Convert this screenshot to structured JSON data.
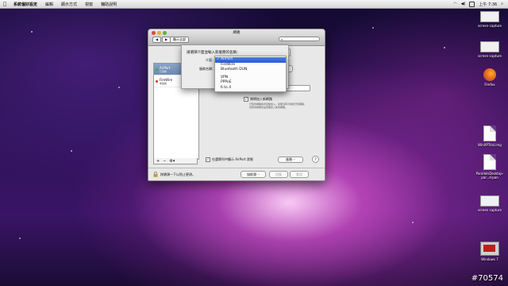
{
  "menubar": {
    "app_name": "系統偏好設定",
    "items": [
      "編輯",
      "顯示方式",
      "視窗",
      "輔助說明"
    ],
    "clock": "上午 7:36",
    "status_icons": [
      "wifi-icon",
      "volume-icon",
      "flag-icon",
      "spotlight-icon"
    ]
  },
  "window": {
    "title": "網路",
    "nav_back": "◀",
    "nav_forward": "▶",
    "show_all": "顯示全部",
    "search_placeholder": ""
  },
  "sheet": {
    "question": "請選擇介面並輸入新服務的名稱：",
    "interface_label": "介面：",
    "service_name_label": "服務名稱："
  },
  "interface_menu": {
    "selected": "AirPort",
    "options": [
      "AirPort",
      "FireWire",
      "Bluetooth DUN",
      "VPN",
      "PPPoE",
      "6 to 4"
    ]
  },
  "services": [
    {
      "name": "AirPort",
      "status": "已連線",
      "color": "#2fb24a",
      "selected": true
    },
    {
      "name": "FireWire",
      "status": "未連線",
      "color": "#d62b2b",
      "selected": false
    }
  ],
  "detail": {
    "airport_button": "AirPort",
    "airport_caption": "個位址",
    "join_networks_label": "詢問加入新網路",
    "join_networks_checked": true,
    "join_networks_desc": "已知的網路將會自動加入。如果沒有可用的已知網路，系統會詢問您是否要加入新的網路。",
    "show_status_label": "在選單列中顯示 AirPort 狀態",
    "show_status_checked": true,
    "advanced_button": "進階⋯",
    "help_button": "?"
  },
  "footer": {
    "lock_text": "按鎖頭一下以防止更改。",
    "assist_button": "協助我⋯",
    "revert_button": "回復",
    "apply_button": "套用"
  },
  "desktop": {
    "icons": [
      {
        "name": "screen-capture",
        "kind": "screenshot"
      },
      {
        "name": "screen-capture",
        "kind": "screenshot"
      },
      {
        "name": "Firefox",
        "kind": "firefox"
      },
      {
        "name": "WinXPTrial.img",
        "kind": "doc"
      },
      {
        "name": "ParallelsDesktop-par...d-pan",
        "kind": "doc"
      },
      {
        "name": "screen capture",
        "kind": "screenshot"
      },
      {
        "name": "Windows 7",
        "kind": "vm"
      }
    ]
  },
  "watermark": "#70574"
}
